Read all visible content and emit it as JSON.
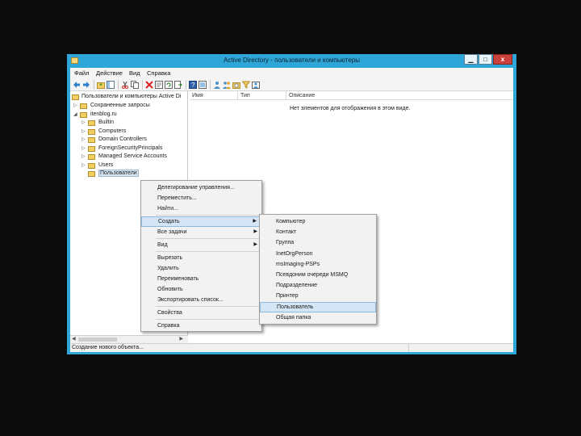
{
  "window": {
    "title": "Active Directory - пользователи и компьютеры",
    "min_glyph": "▁",
    "max_glyph": "□",
    "close_glyph": "x"
  },
  "menubar": [
    "Файл",
    "Действие",
    "Вид",
    "Справка"
  ],
  "toolbar_icons": [
    "back-arrow-icon",
    "forward-arrow-icon",
    "folder-up-icon",
    "show-hide-tree-icon",
    "cut-icon",
    "copy-icon",
    "delete-icon",
    "properties-icon",
    "refresh-icon",
    "export-list-icon",
    "help-icon",
    "console-tree-icon",
    "new-user-icon",
    "new-group-icon",
    "new-ou-icon",
    "filter-icon",
    "add-to-group-icon"
  ],
  "tree": {
    "root_label": "Пользователи и компьютеры Active Di",
    "items": [
      {
        "label": "Сохраненные запросы",
        "arrow": "▷",
        "indent": 1
      },
      {
        "label": "itenblog.ru",
        "arrow": "◢",
        "indent": 1
      },
      {
        "label": "Builtin",
        "arrow": "▷",
        "indent": 2
      },
      {
        "label": "Computers",
        "arrow": "▷",
        "indent": 2
      },
      {
        "label": "Domain Controllers",
        "arrow": "▷",
        "indent": 2
      },
      {
        "label": "ForeignSecurityPrincipals",
        "arrow": "▷",
        "indent": 2
      },
      {
        "label": "Managed Service Accounts",
        "arrow": "▷",
        "indent": 2
      },
      {
        "label": "Users",
        "arrow": "▷",
        "indent": 2
      },
      {
        "label": "Пользователи",
        "arrow": "",
        "indent": 2,
        "selected": true
      }
    ]
  },
  "list": {
    "columns": [
      "Имя",
      "Тип",
      "Описание"
    ],
    "empty_message": "Нет элементов для отображения в этом виде."
  },
  "status": {
    "text": "Создание нового объекта..."
  },
  "context_menu": {
    "items": [
      {
        "label": "Делегирование управления...",
        "sep_after": false
      },
      {
        "label": "Переместить...",
        "sep_after": false
      },
      {
        "label": "Найти...",
        "sep_after": true
      },
      {
        "label": "Создать",
        "submenu": true,
        "highlight": true,
        "sep_after": false
      },
      {
        "label": "Все задачи",
        "submenu": true,
        "sep_after": true
      },
      {
        "label": "Вид",
        "submenu": true,
        "sep_after": true
      },
      {
        "label": "Вырезать",
        "sep_after": false
      },
      {
        "label": "Удалить",
        "sep_after": false
      },
      {
        "label": "Переименовать",
        "sep_after": false
      },
      {
        "label": "Обновить",
        "sep_after": false
      },
      {
        "label": "Экспортировать список...",
        "sep_after": true
      },
      {
        "label": "Свойства",
        "sep_after": true
      },
      {
        "label": "Справка",
        "sep_after": false
      }
    ],
    "submenu_glyph": "▶"
  },
  "create_submenu": {
    "items": [
      {
        "label": "Компьютер"
      },
      {
        "label": "Контакт"
      },
      {
        "label": "Группа"
      },
      {
        "label": "InetOrgPerson"
      },
      {
        "label": "msImaging-PSPs"
      },
      {
        "label": "Псевдоним очереди MSMQ"
      },
      {
        "label": "Подразделение"
      },
      {
        "label": "Принтер"
      },
      {
        "label": "Пользователь",
        "highlight": true
      },
      {
        "label": "Общая папка"
      }
    ]
  },
  "colors": {
    "window_border": "#2fa6d8",
    "highlight_bg": "#d4e6f6",
    "highlight_border": "#8fb8de",
    "close_button": "#c9413a"
  }
}
